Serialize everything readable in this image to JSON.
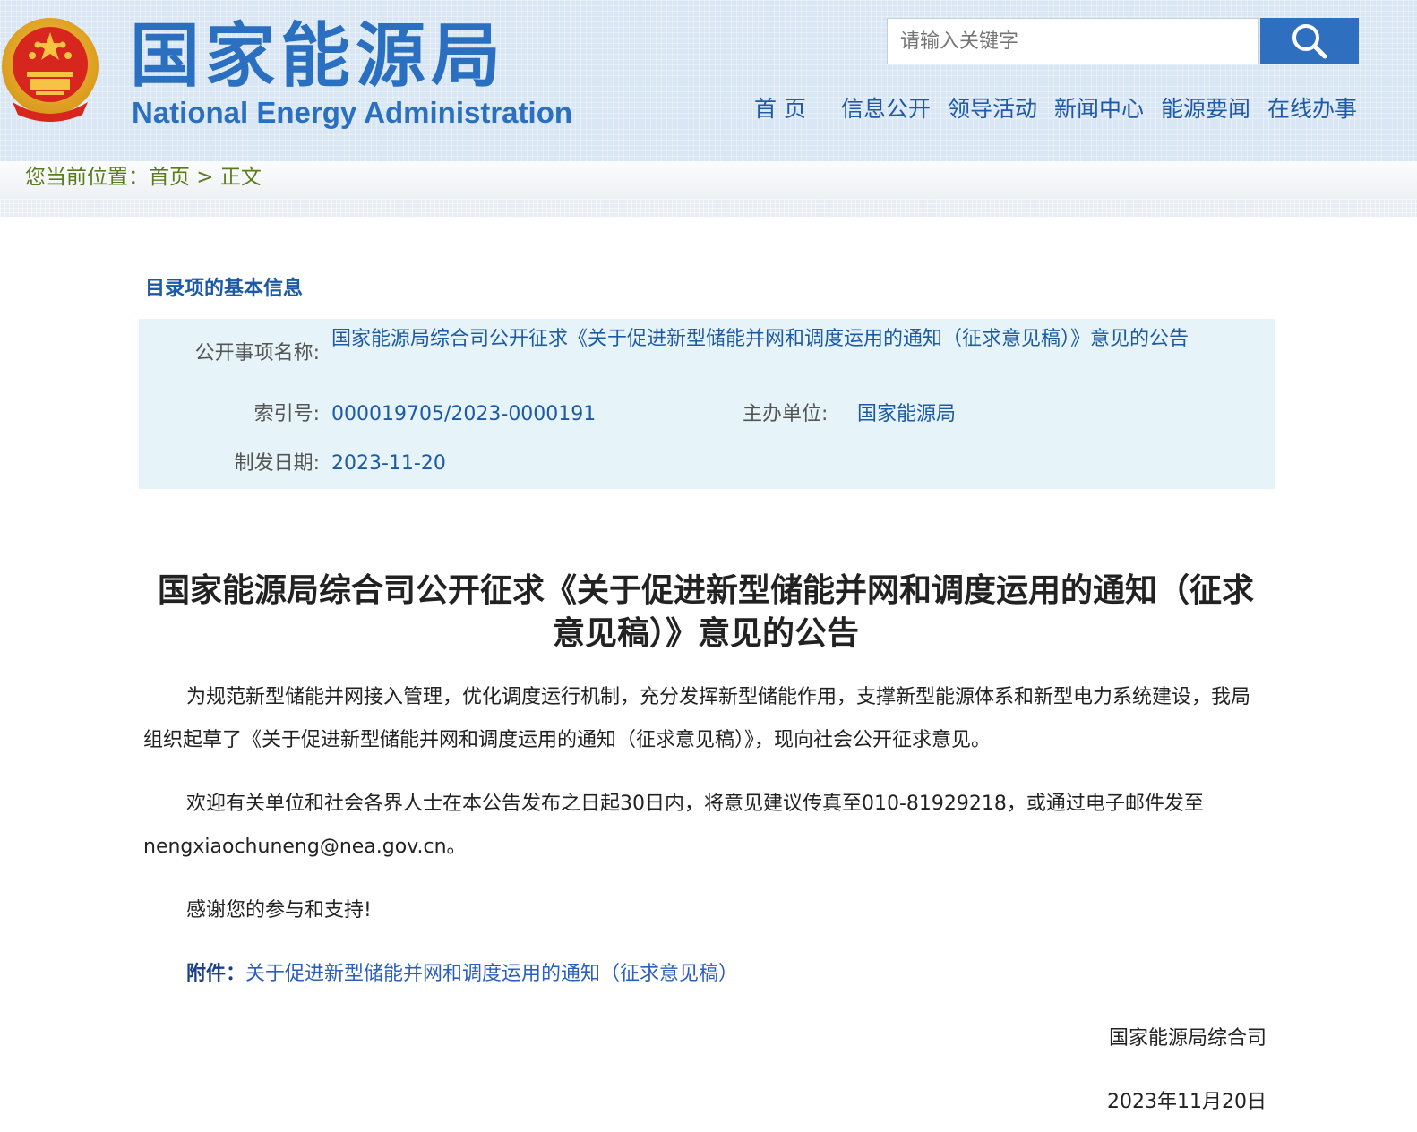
{
  "header": {
    "logo_cn": "国家能源局",
    "logo_en": "National Energy Administration",
    "search": {
      "placeholder": "请输入关键字"
    },
    "nav": [
      {
        "label": "首 页"
      },
      {
        "label": "信息公开"
      },
      {
        "label": "领导活动"
      },
      {
        "label": "新闻中心"
      },
      {
        "label": "能源要闻"
      },
      {
        "label": "在线办事"
      }
    ],
    "colors": {
      "brand": "#2a6fc0",
      "header_bg": "#d9e6f4"
    }
  },
  "breadcrumb": {
    "prefix": "您当前位置：",
    "home": "首页",
    "separator": " > ",
    "current": "正文"
  },
  "info": {
    "section_title": "目录项的基本信息",
    "name_label": "公开事项名称:",
    "name_value": "国家能源局综合司公开征求《关于促进新型储能并网和调度运用的通知（征求意见稿）》意见的公告",
    "index_label": "索引号:",
    "index_value": "000019705/2023-0000191",
    "org_label": "主办单位:",
    "org_value": "国家能源局",
    "date_label": "制发日期:",
    "date_value": "2023-11-20"
  },
  "article": {
    "title": "国家能源局综合司公开征求《关于促进新型储能并网和调度运用的通知（征求意见稿）》意见的公告",
    "para1": "为规范新型储能并网接入管理，优化调度运行机制，充分发挥新型储能作用，支撑新型能源体系和新型电力系统建设，我局组织起草了《关于促进新型储能并网和调度运用的通知（征求意见稿）》，现向社会公开征求意见。",
    "para2": "欢迎有关单位和社会各界人士在本公告发布之日起30日内，将意见建议传真至010-81929218，或通过电子邮件发至nengxiaochuneng@nea.gov.cn。",
    "para3": "感谢您的参与和支持!",
    "attachment_label": "附件：",
    "attachment_link": "关于促进新型储能并网和调度运用的通知（征求意见稿）",
    "signature_org": "国家能源局综合司",
    "signature_date": "2023年11月20日"
  }
}
